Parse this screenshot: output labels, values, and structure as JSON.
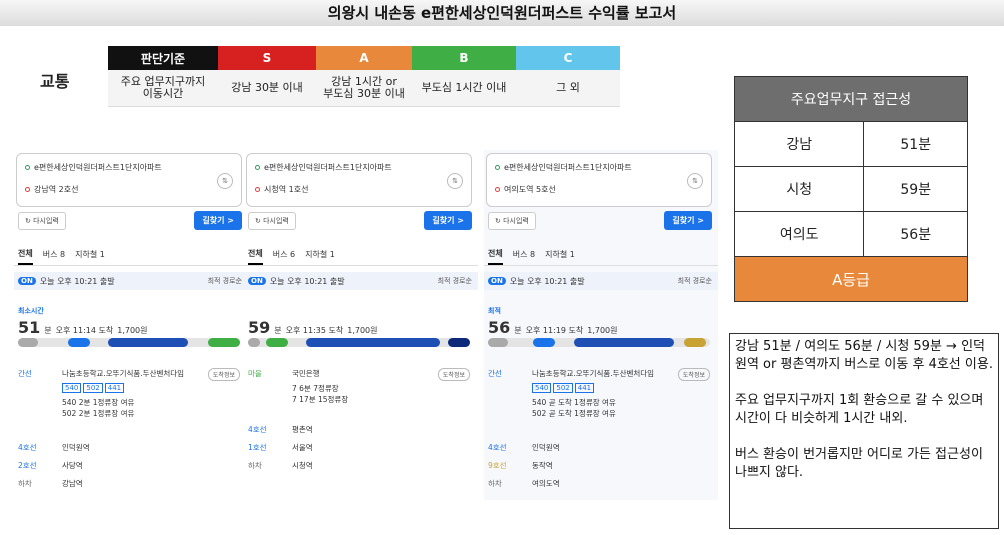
{
  "title": "의왕시 내손동 e편한세상인덕원더퍼스트 수익률 보고서",
  "transport": {
    "label": "교통",
    "table": {
      "headers": [
        "판단기준",
        "S",
        "A",
        "B",
        "C"
      ],
      "header_colors": [
        "#111111",
        "#d72020",
        "#e8883a",
        "#3fae44",
        "#62c6ec"
      ],
      "row": [
        "주요 업무지구까지\n이동시간",
        "강남 30분 이내",
        "강남 1시간 or\n부도심 30분 이내",
        "부도심 1시간 이내",
        "그 외"
      ]
    }
  },
  "panels": [
    {
      "from": "e편한세상인덕원더퍼스트1단지아파트",
      "to": "강남역 2호선",
      "reset": "다시입력",
      "search": "길찾기 >",
      "tabs": [
        "전체",
        "버스 8",
        "지하철 1"
      ],
      "on_badge": "ON",
      "depart": "오늘 오후 10:21 출발",
      "sort": "최적 경로순",
      "tag": "최소시간",
      "minutes": "51",
      "unit": "분",
      "arrive": "오후 11:14 도착",
      "fare": "1,700원",
      "segments": [
        "10분",
        "3분",
        "4분",
        "16분",
        "2분",
        "9분"
      ],
      "steps": [
        {
          "label": "간선",
          "place": "나눔초등학교.오뚜기식품.두산벤처다임",
          "buses": [
            "540",
            "502",
            "441"
          ],
          "info": [
            "540 2분 1정류장 여유",
            "502 2분 1정류장 여유"
          ]
        },
        {
          "label": "4호선",
          "place": "인덕원역"
        },
        {
          "label": "2호선",
          "place": "사당역"
        },
        {
          "label": "하차",
          "place": "강남역"
        }
      ],
      "detail": "도착정보"
    },
    {
      "from": "e편한세상인덕원더퍼스트1단지아파트",
      "to": "시청역 1호선",
      "reset": "다시입력",
      "search": "길찾기 >",
      "tabs": [
        "전체",
        "버스 6",
        "지하철 1"
      ],
      "on_badge": "ON",
      "depart": "오늘 오후 10:21 출발",
      "sort": "최적 경로순",
      "tag": "",
      "minutes": "59",
      "unit": "분",
      "arrive": "오후 11:35 도착",
      "fare": "1,700원",
      "segments": [
        "5분",
        "5분",
        "3분",
        "35분",
        "7분",
        "2분"
      ],
      "steps": [
        {
          "label": "마을",
          "place": "국민은행",
          "buses": [],
          "info": [
            "7 6분 7정류장",
            "7 17분 15정류장"
          ]
        },
        {
          "label": "4호선",
          "place": "평촌역"
        },
        {
          "label": "1호선",
          "place": "서울역"
        },
        {
          "label": "하차",
          "place": "시청역"
        }
      ],
      "detail": "도착정보"
    },
    {
      "from": "e편한세상인덕원더퍼스트1단지아파트",
      "to": "여의도역 5호선",
      "reset": "다시입력",
      "search": "길찾기 >",
      "tabs": [
        "전체",
        "버스 8",
        "지하철 1"
      ],
      "on_badge": "ON",
      "depart": "오늘 오후 10:21 출발",
      "sort": "최적 경로순",
      "tag": "최적",
      "minutes": "56",
      "unit": "분",
      "arrive": "오후 11:19 도착",
      "fare": "1,700원",
      "segments": [
        "10분",
        "3분",
        "4분",
        "21분",
        "5분",
        "7분",
        "0분"
      ],
      "steps": [
        {
          "label": "간선",
          "place": "나눔초등학교.오뚜기식품.두산벤처다임",
          "buses": [
            "540",
            "502",
            "441"
          ],
          "info": [
            "540 곧 도착 1정류장 여유",
            "502 곧 도착 1정류장 여유"
          ]
        },
        {
          "label": "4호선",
          "place": "인덕원역"
        },
        {
          "label": "9호선",
          "place": "동작역"
        },
        {
          "label": "하차",
          "place": "여의도역"
        }
      ],
      "detail": "도착정보"
    }
  ],
  "access": {
    "header": "주요업무지구 접근성",
    "rows": [
      [
        "강남",
        "51분"
      ],
      [
        "시청",
        "59분"
      ],
      [
        "여의도",
        "56분"
      ]
    ],
    "grade": "A등급"
  },
  "note": [
    "강남 51분 / 여의도 56분 / 시청 59분 → 인덕원역 or 평촌역까지 버스로 이동 후 4호선 이용.",
    "주요 업무지구까지 1회 환승으로 갈 수 있으며 시간이 다 비슷하게 1시간 내외.",
    "버스 환승이 번거롭지만 어디로 가든 접근성이 나쁘지 않다."
  ]
}
